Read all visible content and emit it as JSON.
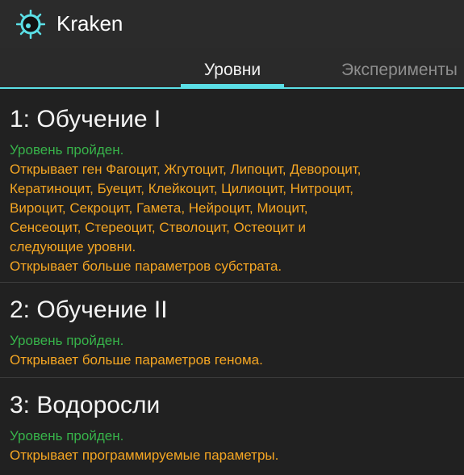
{
  "app": {
    "title": "Kraken",
    "logo_icon": "kraken-logo-icon"
  },
  "tabs": [
    {
      "label": "Уровни",
      "selected": true
    },
    {
      "label": "Эксперименты",
      "selected": false
    }
  ],
  "colors": {
    "accent": "#5bdfe6",
    "status_passed": "#37b34a",
    "description": "#f5a623",
    "background": "#212121"
  },
  "levels": [
    {
      "title": "1: Обучение I",
      "status": "Уровень пройден.",
      "desc_lines": [
        "Открывает ген Фагоцит, Жгутоцит, Липоцит, Девороцит,",
        "Кератиноцит, Буецит, Клейкоцит, Цилиоцит, Нитроцит,",
        "Вироцит, Секроцит, Гамета, Нейроцит, Миоцит,",
        "Сенсеоцит, Стереоцит, Стволоцит, Остеоцит и",
        "следующие уровни.",
        "Открывает больше параметров субстрата."
      ]
    },
    {
      "title": "2: Обучение II",
      "status": "Уровень пройден.",
      "desc_lines": [
        "Открывает больше параметров генома."
      ]
    },
    {
      "title": "3: Водоросли",
      "status": "Уровень пройден.",
      "desc_lines": [
        "Открывает программируемые параметры."
      ]
    }
  ]
}
